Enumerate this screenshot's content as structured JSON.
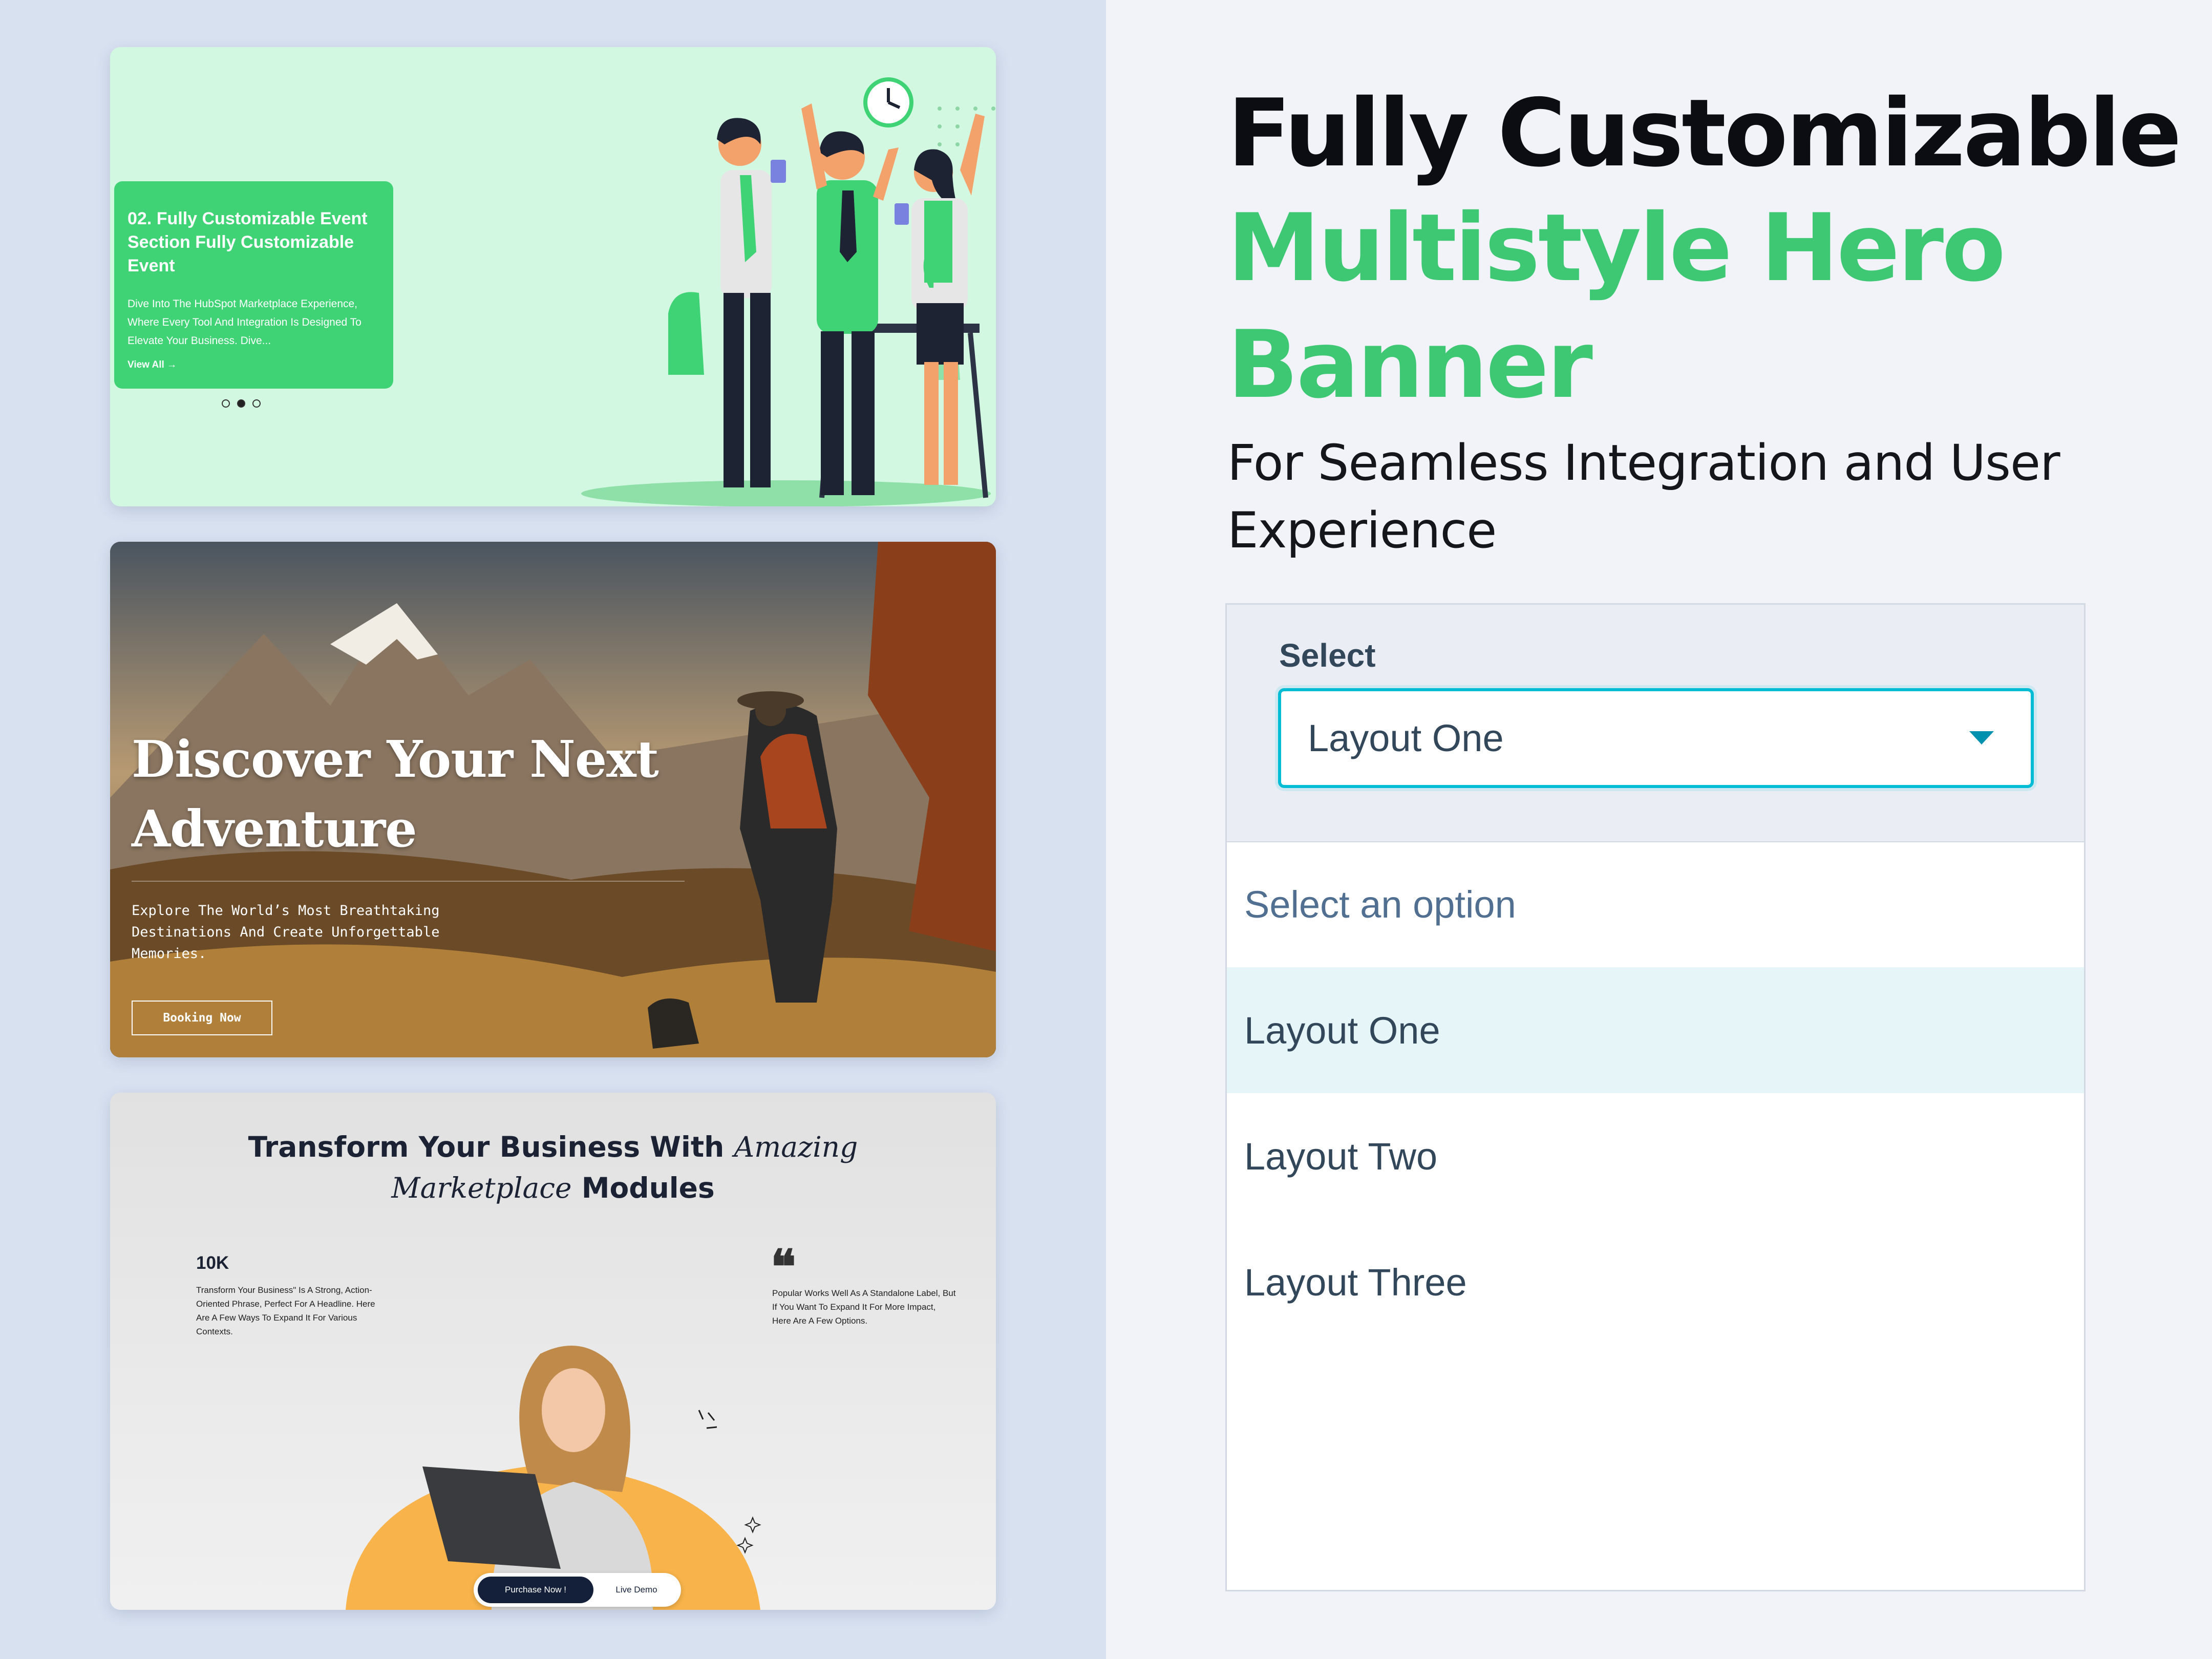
{
  "card1": {
    "title": "02. Fully Customizable Event Section Fully Customizable Event",
    "description": "Dive Into The HubSpot Marketplace Experience, Where Every Tool And Integration Is Designed To Elevate Your Business. Dive...",
    "link": "View All  →",
    "slide_count": 3,
    "active_slide": 2
  },
  "card2": {
    "title": "Discover Your Next Adventure",
    "description": "Explore The World’s Most Breathtaking Destinations And Create Unforgettable Memories.",
    "button": "Booking Now"
  },
  "card3": {
    "title_part1": "Transform Your Business With",
    "title_italic1": "Amazing",
    "title_italic2": "Marketplace",
    "title_part2": "Modules",
    "stat_value": "10K",
    "stat_text": "Transform Your Business\" Is A Strong, Action-Oriented Phrase, Perfect For A Headline. Here Are A Few Ways To Expand It For Various Contexts.",
    "quote_mark": "❝",
    "quote_text": "Popular Works Well As A Standalone Label, But If You Want To Expand It For More Impact, Here Are A Few Options.",
    "primary_button": "Purchase Now !",
    "secondary_button": "Live Demo"
  },
  "heading": {
    "line1": "Fully Customizable",
    "line2": "Multistyle Hero Banner",
    "subtitle": "For Seamless Integration and User Experience"
  },
  "select": {
    "label": "Select",
    "value": "Layout One",
    "options": [
      {
        "label": "Select an option"
      },
      {
        "label": "Layout One",
        "selected": true
      },
      {
        "label": "Layout Two"
      },
      {
        "label": "Layout Three"
      }
    ]
  },
  "colors": {
    "accent_green": "#3ec874",
    "focus_cyan": "#00bcd4",
    "option_highlight": "#e5f5f8",
    "left_background": "#d8e1f0"
  }
}
